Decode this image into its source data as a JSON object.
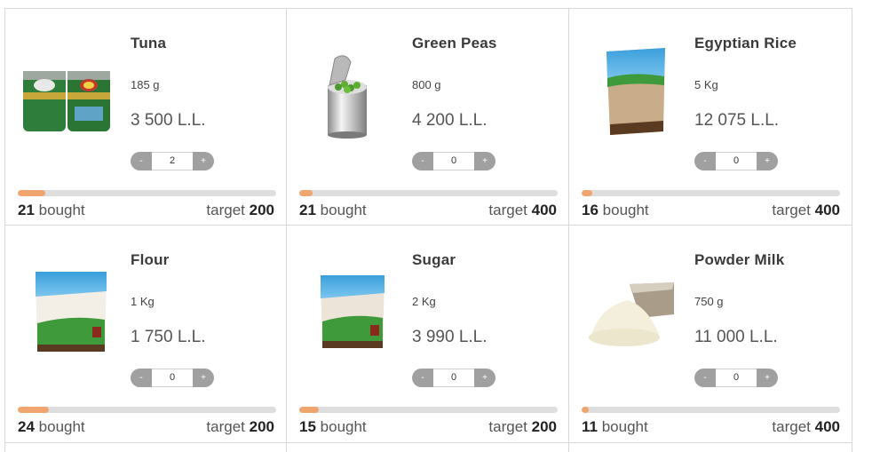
{
  "products": [
    {
      "name": "Tuna",
      "size": "185 g",
      "price": "3 500 L.L.",
      "quantity": "2",
      "bought_count": "21",
      "bought_label": "bought",
      "target_label": "target",
      "target_count": "200",
      "progress": 0.105,
      "image": "tuna-cans-image"
    },
    {
      "name": "Green Peas",
      "size": "800 g",
      "price": "4 200 L.L.",
      "quantity": "0",
      "bought_count": "21",
      "bought_label": "bought",
      "target_label": "target",
      "target_count": "400",
      "progress": 0.0525,
      "image": "green-peas-can-image"
    },
    {
      "name": "Egyptian Rice",
      "size": "5 Kg",
      "price": "12 075 L.L.",
      "quantity": "0",
      "bought_count": "16",
      "bought_label": "bought",
      "target_label": "target",
      "target_count": "400",
      "progress": 0.04,
      "image": "rice-bag-image"
    },
    {
      "name": "Flour",
      "size": "1 Kg",
      "price": "1 750 L.L.",
      "quantity": "0",
      "bought_count": "24",
      "bought_label": "bought",
      "target_label": "target",
      "target_count": "200",
      "progress": 0.12,
      "image": "flour-bag-image"
    },
    {
      "name": "Sugar",
      "size": "2 Kg",
      "price": "3 990 L.L.",
      "quantity": "0",
      "bought_count": "15",
      "bought_label": "bought",
      "target_label": "target",
      "target_count": "200",
      "progress": 0.075,
      "image": "sugar-bag-image"
    },
    {
      "name": "Powder Milk",
      "size": "750 g",
      "price": "11 000 L.L.",
      "quantity": "0",
      "bought_count": "11",
      "bought_label": "bought",
      "target_label": "target",
      "target_count": "400",
      "progress": 0.0275,
      "image": "powder-milk-image"
    }
  ],
  "stepper": {
    "minus": "-",
    "plus": "+"
  },
  "colors": {
    "progress_fill": "#f0a46e",
    "progress_track": "#dedede",
    "stepper_button": "#a0a0a0",
    "border": "#d8d8d8"
  }
}
